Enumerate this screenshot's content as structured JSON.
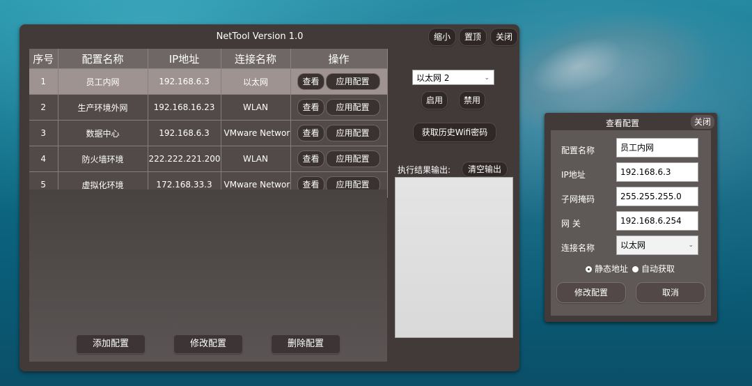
{
  "window": {
    "title": "NetTool Version 1.0",
    "minimize_label": "缩小",
    "pin_label": "置顶",
    "close_label": "关闭"
  },
  "table": {
    "headers": [
      "序号",
      "配置名称",
      "IP地址",
      "连接名称",
      "操作"
    ],
    "view_label": "查看",
    "apply_label": "应用配置",
    "rows": [
      {
        "no": "1",
        "name": "员工内网",
        "ip": "192.168.6.3",
        "conn": "以太网"
      },
      {
        "no": "2",
        "name": "生产环境外网",
        "ip": "192.168.16.23",
        "conn": "WLAN"
      },
      {
        "no": "3",
        "name": "数据中心",
        "ip": "192.168.6.3",
        "conn": "VMware Network"
      },
      {
        "no": "4",
        "name": "防火墙环境",
        "ip": "222.222.221.200",
        "conn": "WLAN"
      },
      {
        "no": "5",
        "name": "虚拟化环境",
        "ip": "172.168.33.3",
        "conn": "VMware Network"
      }
    ]
  },
  "bottom": {
    "add_label": "添加配置",
    "edit_label": "修改配置",
    "delete_label": "删除配置"
  },
  "side": {
    "adapter_selected": "以太网 2",
    "enable_label": "启用",
    "disable_label": "禁用",
    "wifi_label": "获取历史Wifi密码",
    "output_label": "执行结果输出:",
    "clear_label": "清空输出"
  },
  "dialog": {
    "title": "查看配置",
    "close_label": "关闭",
    "name_label": "配置名称",
    "name_value": "员工内网",
    "ip_label": "IP地址",
    "ip_value": "192.168.6.3",
    "mask_label": "子网掩码",
    "mask_value": "255.255.255.0",
    "gateway_label": "网 关",
    "gateway_value": "192.168.6.254",
    "conn_label": "连接名称",
    "conn_value": "以太网",
    "static_label": "静态地址",
    "dhcp_label": "自动获取",
    "modify_label": "修改配置",
    "cancel_label": "取消"
  }
}
